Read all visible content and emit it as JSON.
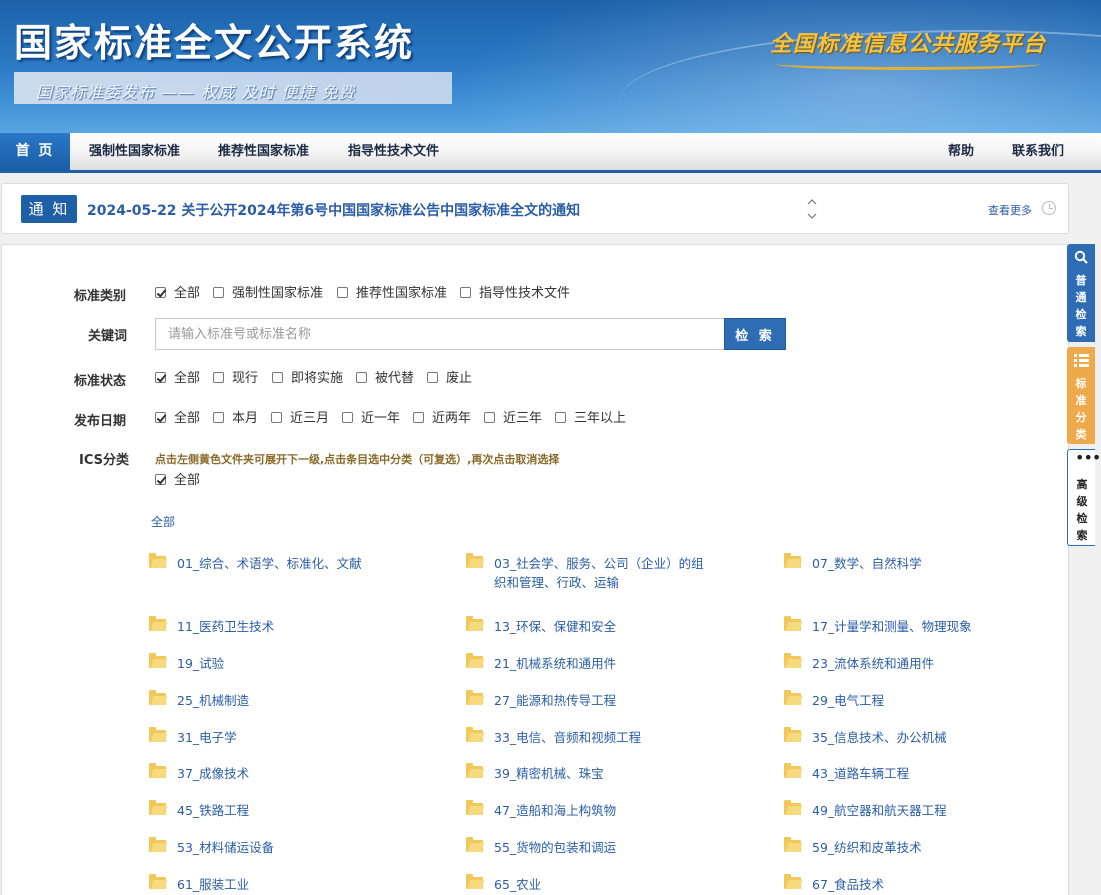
{
  "header": {
    "site_title": "国家标准全文公开系统",
    "slogan": "国家标准委发布 —— 权威 及时 便捷 免费",
    "platform_name": "全国标准信息公共服务平台"
  },
  "nav": {
    "home": "首 页",
    "mandatory": "强制性国家标准",
    "recommended": "推荐性国家标准",
    "guidance": "指导性技术文件",
    "help": "帮助",
    "contact": "联系我们"
  },
  "notice": {
    "badge": "通 知",
    "text": "2024-05-22  关于公开2024年第6号中国国家标准公告中国家标准全文的通知",
    "more": "查看更多"
  },
  "form": {
    "category": {
      "label": "标准类别",
      "options": [
        "全部",
        "强制性国家标准",
        "推荐性国家标准",
        "指导性技术文件"
      ]
    },
    "keyword": {
      "label": "关键词",
      "placeholder": "请输入标准号或标准名称",
      "button": "检 索"
    },
    "status": {
      "label": "标准状态",
      "options": [
        "全部",
        "现行",
        "即将实施",
        "被代替",
        "废止"
      ]
    },
    "date": {
      "label": "发布日期",
      "options": [
        "全部",
        "本月",
        "近三月",
        "近一年",
        "近两年",
        "近三年",
        "三年以上"
      ]
    },
    "ics": {
      "label": "ICS分类",
      "hint": "点击左侧黄色文件夹可展开下一级,点击条目选中分类（可复选）,再次点击取消选择",
      "all_option": "全部",
      "all_link": "全部",
      "items": [
        "01_综合、术语学、标准化、文献",
        "03_社会学、服务、公司（企业）的组织和管理、行政、运输",
        "07_数学、自然科学",
        "11_医药卫生技术",
        "13_环保、保健和安全",
        "17_计量学和测量、物理现象",
        "19_试验",
        "21_机械系统和通用件",
        "23_流体系统和通用件",
        "25_机械制造",
        "27_能源和热传导工程",
        "29_电气工程",
        "31_电子学",
        "33_电信、音频和视频工程",
        "35_信息技术、办公机械",
        "37_成像技术",
        "39_精密机械、珠宝",
        "43_道路车辆工程",
        "45_铁路工程",
        "47_造船和海上构筑物",
        "49_航空器和航天器工程",
        "53_材料储运设备",
        "55_货物的包装和调运",
        "59_纺织和皮革技术",
        "61_服装工业",
        "65_农业",
        "67_食品技术"
      ]
    }
  },
  "side": {
    "normal_search": "普通检索",
    "classify": "标准分类",
    "advanced": "高级检索"
  },
  "colors": {
    "brand_blue": "#1f5fa6",
    "link_blue": "#2b5ea5",
    "folder_yellow": "#f2c85b",
    "classify_orange": "#eda94a"
  }
}
